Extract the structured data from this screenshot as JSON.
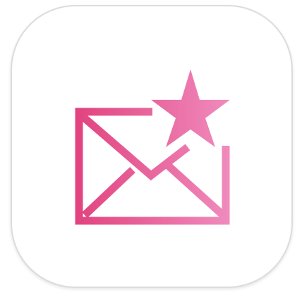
{
  "app_icon": {
    "icon": "mail-star-icon",
    "colors": {
      "gradient_start": "#e1437f",
      "gradient_end": "#f08bbd",
      "tile_background": "#ffffff",
      "tile_border": "#dcdcdc"
    }
  }
}
